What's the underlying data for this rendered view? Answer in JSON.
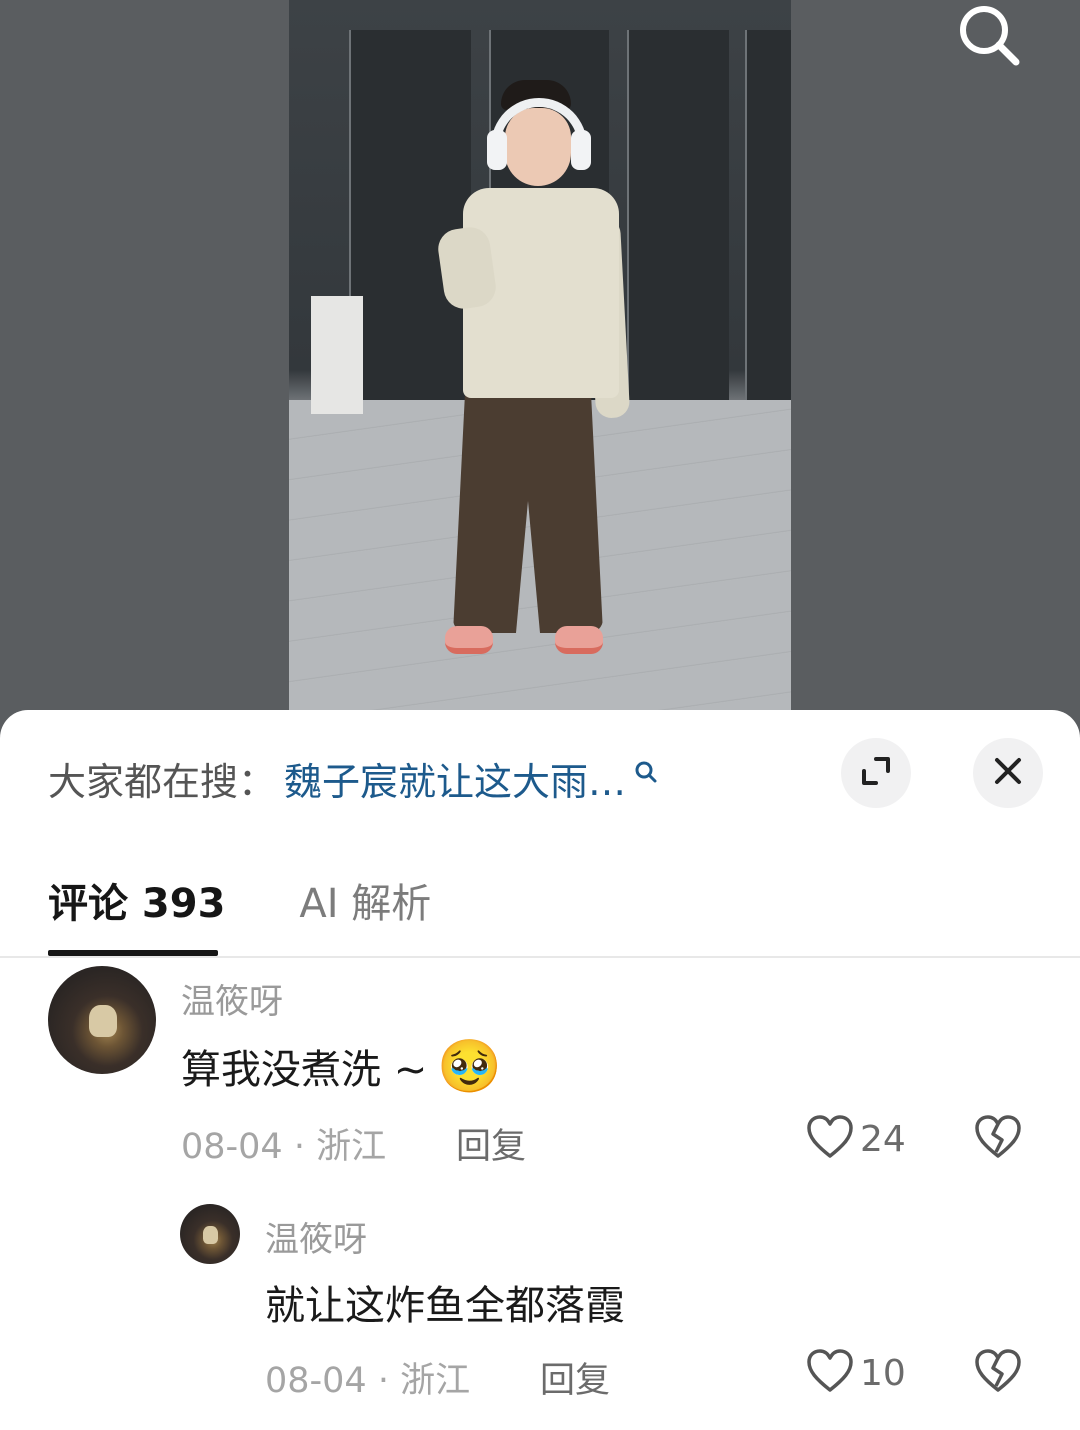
{
  "video": {
    "search_icon": "search-icon"
  },
  "hot_search": {
    "label": "大家都在搜：",
    "query": "魏子宸就让这大雨…",
    "icon": "search-icon"
  },
  "buttons": {
    "expand_icon": "expand-icon",
    "close_icon": "close-icon"
  },
  "tabs": {
    "comments": "评论 393",
    "ai": "AI 解析"
  },
  "comments": [
    {
      "username": "温筱呀",
      "text": "算我没煮洗 ~",
      "emoji": "🥹",
      "meta": "08-04 · 浙江",
      "reply": "回复",
      "likes": "24"
    },
    {
      "username": "温筱呀",
      "text": "就让这炸鱼全都落霞",
      "meta": "08-04 · 浙江",
      "reply": "回复",
      "likes": "10"
    }
  ]
}
